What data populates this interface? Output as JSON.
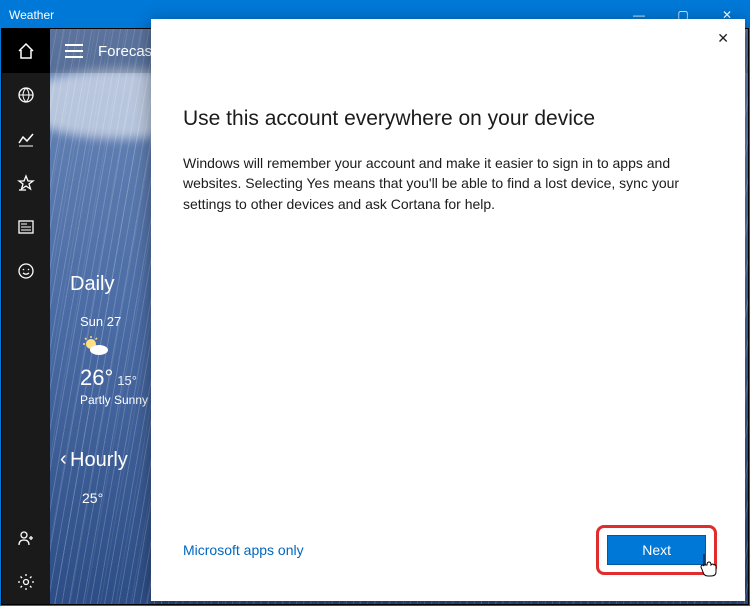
{
  "window": {
    "title": "Weather",
    "controls": {
      "min": "—",
      "max": "▢",
      "close": "✕"
    }
  },
  "topbar": {
    "label": "Forecast"
  },
  "sidebar": {
    "home": "⌂",
    "map": "◎",
    "chart": "≋",
    "fav": "☆",
    "news": "▢",
    "feedback": "☺",
    "profile": "👤",
    "settings": "⚙"
  },
  "forecast": {
    "daily_title": "Daily",
    "hourly_title": "Hourly",
    "cards": [
      {
        "day": "Sun 27",
        "high": "26°",
        "low": "15°",
        "cond": "Partly Sunny"
      }
    ],
    "hourly_temp": "25°",
    "nav_left": "‹"
  },
  "modal": {
    "close": "✕",
    "title": "Use this account everywhere on your device",
    "body": "Windows will remember your account and make it easier to sign in to apps and websites. Selecting Yes means that you'll be able to find a lost device, sync your settings to other devices and ask Cortana for help.",
    "link": "Microsoft apps only",
    "next": "Next"
  }
}
